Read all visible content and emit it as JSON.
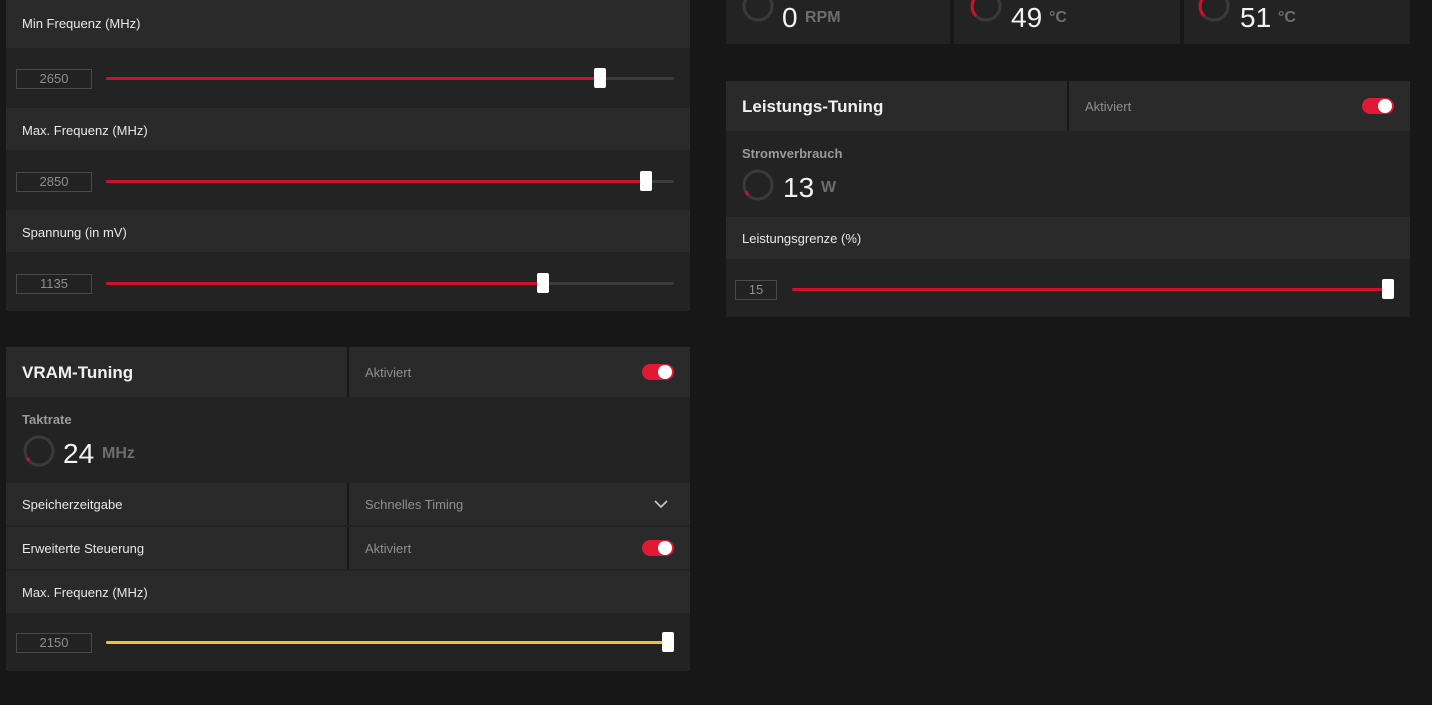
{
  "colors": {
    "accent": "#d0102c",
    "vram_fill": "#f2c230",
    "background": "#171717",
    "panel": "#232323"
  },
  "gpu_tuning": {
    "min_freq_label": "Min Frequenz (MHz)",
    "min_freq_value": "2650",
    "min_freq_fraction": 0.87,
    "max_freq_label": "Max. Frequenz (MHz)",
    "max_freq_value": "2850",
    "max_freq_fraction": 0.95,
    "voltage_label": "Spannung (in mV)",
    "voltage_value": "1135",
    "voltage_fraction": 0.77
  },
  "vram_tuning": {
    "title": "VRAM-Tuning",
    "status": "Aktiviert",
    "clock_label": "Taktrate",
    "clock_value": "24",
    "clock_unit": "MHz",
    "memory_timing_label": "Speicherzeitgabe",
    "memory_timing_value": "Schnelles Timing",
    "advanced_control_label": "Erweiterte Steuerung",
    "advanced_control_status": "Aktiviert",
    "max_freq_label": "Max. Frequenz (MHz)",
    "max_freq_value": "2150",
    "max_freq_fraction": 1.0
  },
  "sensors": {
    "fan_value": "0",
    "fan_unit": "RPM",
    "temp1_value": "49",
    "temp1_unit": "°C",
    "temp2_value": "51",
    "temp2_unit": "°C"
  },
  "power_tuning": {
    "title": "Leistungs-Tuning",
    "status": "Aktiviert",
    "consumption_label": "Stromverbrauch",
    "consumption_value": "13",
    "consumption_unit": "W",
    "limit_label": "Leistungsgrenze (%)",
    "limit_value": "15",
    "limit_fraction": 1.0
  }
}
